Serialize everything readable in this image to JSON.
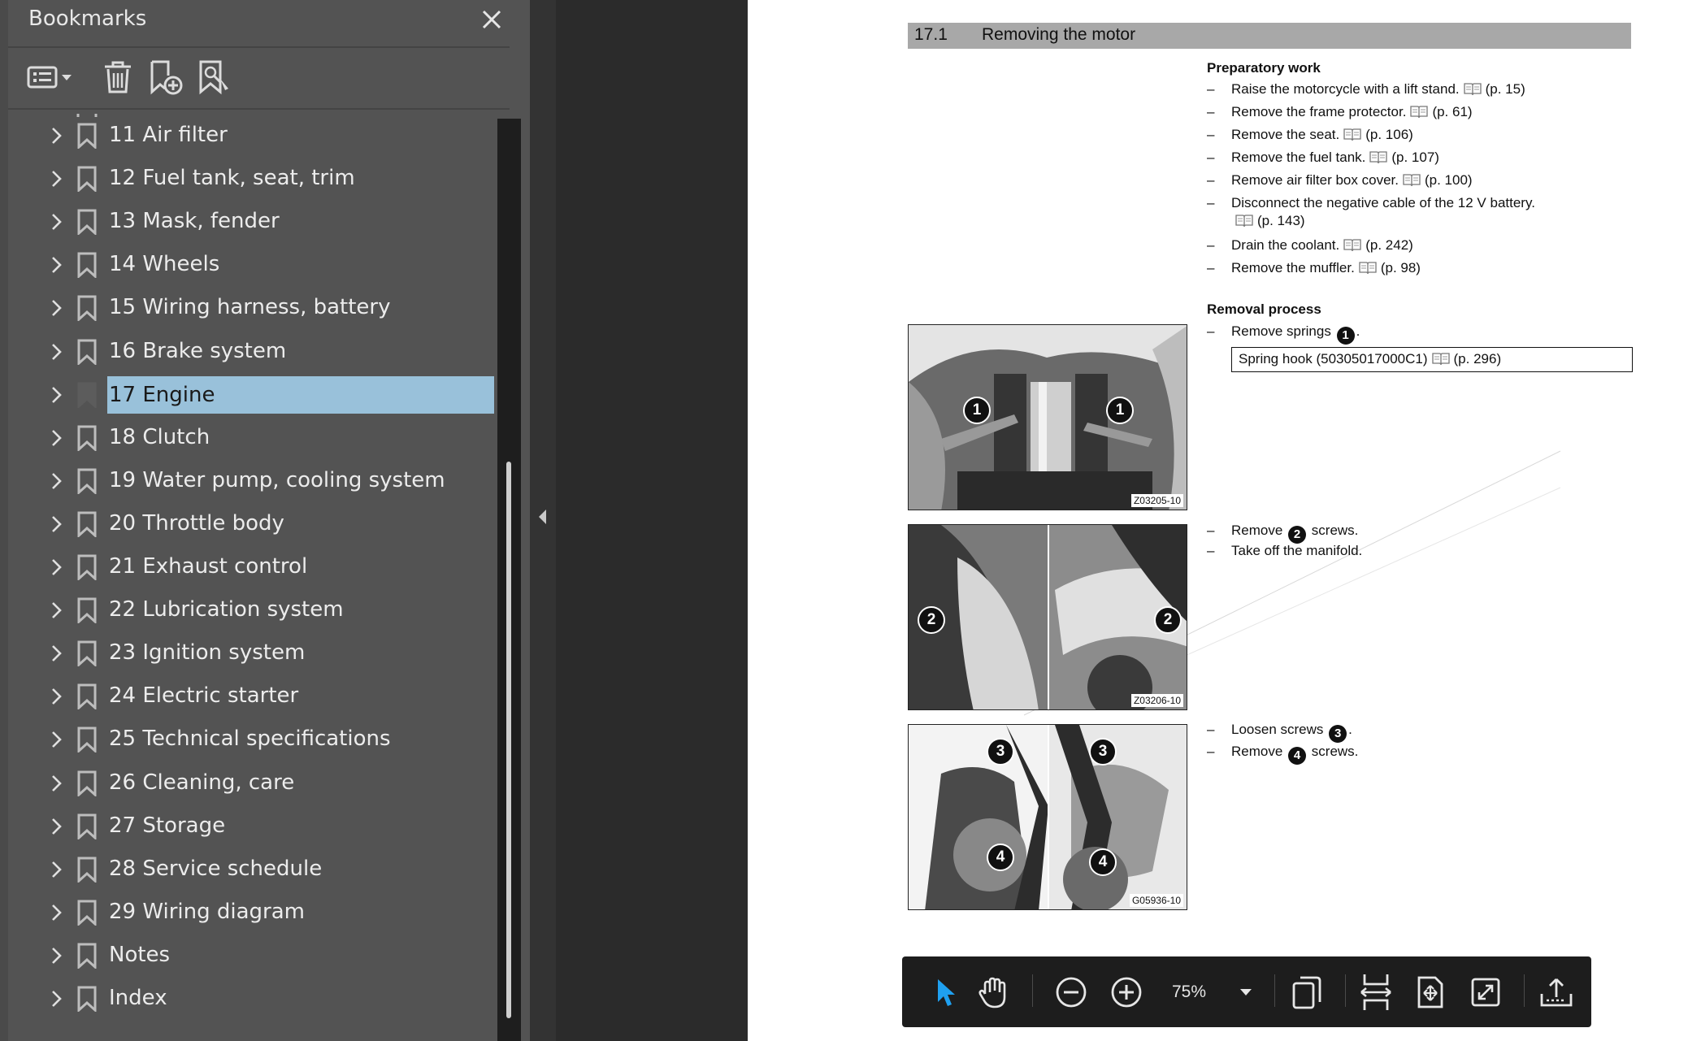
{
  "bookmarks_panel": {
    "title": "Bookmarks",
    "items": [
      {
        "label": "11 Air filter",
        "selected": false
      },
      {
        "label": "12 Fuel tank, seat, trim",
        "selected": false
      },
      {
        "label": "13 Mask, fender",
        "selected": false
      },
      {
        "label": "14 Wheels",
        "selected": false
      },
      {
        "label": "15 Wiring harness, battery",
        "selected": false
      },
      {
        "label": "16 Brake system",
        "selected": false
      },
      {
        "label": "17 Engine",
        "selected": true
      },
      {
        "label": "18 Clutch",
        "selected": false
      },
      {
        "label": "19 Water pump, cooling system",
        "selected": false
      },
      {
        "label": "20 Throttle body",
        "selected": false
      },
      {
        "label": "21 Exhaust control",
        "selected": false
      },
      {
        "label": "22 Lubrication system",
        "selected": false
      },
      {
        "label": "23 Ignition system",
        "selected": false
      },
      {
        "label": "24 Electric starter",
        "selected": false
      },
      {
        "label": "25 Technical specifications",
        "selected": false
      },
      {
        "label": "26 Cleaning, care",
        "selected": false
      },
      {
        "label": "27 Storage",
        "selected": false
      },
      {
        "label": "28 Service schedule",
        "selected": false
      },
      {
        "label": "29 Wiring diagram",
        "selected": false
      },
      {
        "label": "Notes",
        "selected": false
      },
      {
        "label": "Index",
        "selected": false
      }
    ],
    "toolbar_icons": [
      "options-menu-icon",
      "delete-bookmark-icon",
      "add-bookmark-icon",
      "find-bookmark-icon"
    ],
    "selection_color": "#99c1da"
  },
  "document": {
    "section_number": "17.1",
    "section_title": "Removing the motor",
    "preparatory": {
      "heading": "Preparatory work",
      "steps": [
        {
          "dash": "–",
          "text": "Raise the motorcycle with a lift stand.",
          "ref": "(p. 15)"
        },
        {
          "dash": "–",
          "text": "Remove the frame protector.",
          "ref": "(p. 61)"
        },
        {
          "dash": "–",
          "text": "Remove the seat.",
          "ref": "(p. 106)"
        },
        {
          "dash": "–",
          "text": "Remove the fuel tank.",
          "ref": "(p. 107)"
        },
        {
          "dash": "–",
          "text": "Remove air filter box cover.",
          "ref": "(p. 100)"
        },
        {
          "dash": "–",
          "text": "Disconnect the negative cable of the 12 V battery.",
          "ref": "(p. 143)"
        },
        {
          "dash": "–",
          "text": "Drain the coolant.",
          "ref": "(p. 242)"
        },
        {
          "dash": "–",
          "text": "Remove the muffler.",
          "ref": "(p. 98)"
        }
      ]
    },
    "removal": {
      "heading": "Removal process",
      "step1": {
        "dash": "–",
        "pre": "Remove springs",
        "num": "1",
        "post": "."
      },
      "tool": {
        "name": "Spring hook (50305017000C1)",
        "ref": "(p. 296)"
      },
      "step2": {
        "dash": "–",
        "pre": "Remove",
        "num": "2",
        "post": "screws."
      },
      "step3": {
        "dash": "–",
        "text": "Take off the manifold."
      },
      "step4": {
        "dash": "–",
        "pre": "Loosen screws",
        "num": "3",
        "post": "."
      },
      "step5": {
        "dash": "–",
        "pre": "Remove",
        "num": "4",
        "post": "screws."
      }
    },
    "figures": [
      {
        "code": "Z03205-10",
        "callouts": [
          "1",
          "1"
        ]
      },
      {
        "code": "Z03206-10",
        "callouts": [
          "2",
          "2"
        ]
      },
      {
        "code": "G05936-10",
        "callouts": [
          "3",
          "3",
          "4",
          "4"
        ]
      }
    ]
  },
  "viewer_toolbar": {
    "zoom": "75%",
    "icons": [
      "select-tool-icon",
      "hand-tool-icon",
      "zoom-out-icon",
      "zoom-in-icon",
      "zoom-dropdown-icon",
      "page-display-icon",
      "fit-width-icon",
      "fit-page-icon",
      "full-screen-icon",
      "share-icon"
    ],
    "active_tool_color": "#1fa0f0"
  }
}
